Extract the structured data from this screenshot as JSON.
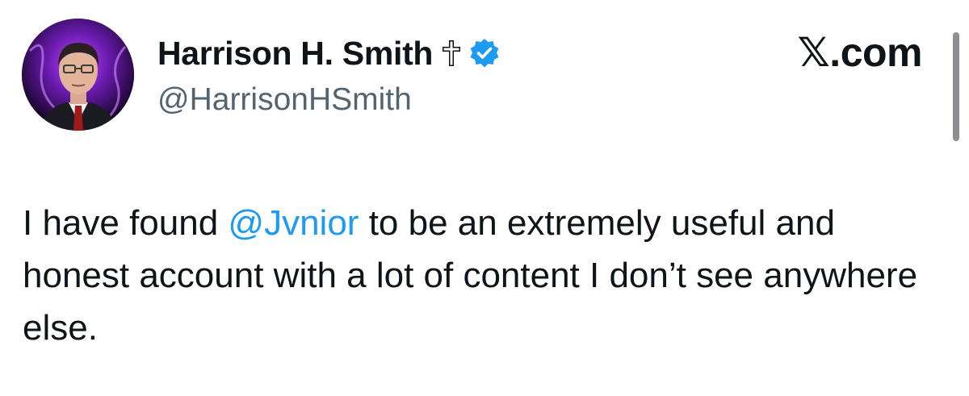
{
  "author": {
    "display_name": "Harrison H. Smith",
    "handle": "@HarrisonHSmith",
    "name_emoji_icon": "latin-cross-icon",
    "verified_icon": "verified-badge-icon",
    "verified_color": "#1d9bf0"
  },
  "brand": {
    "logo_glyph": "𝕏",
    "domain": ".com"
  },
  "tweet": {
    "text_before_mention": "I have found ",
    "mention": "@Jvnior",
    "text_after_mention": " to be an extremely useful and honest account with a lot of content I don’t see anywhere else.",
    "mention_color": "#1d9bf0"
  }
}
